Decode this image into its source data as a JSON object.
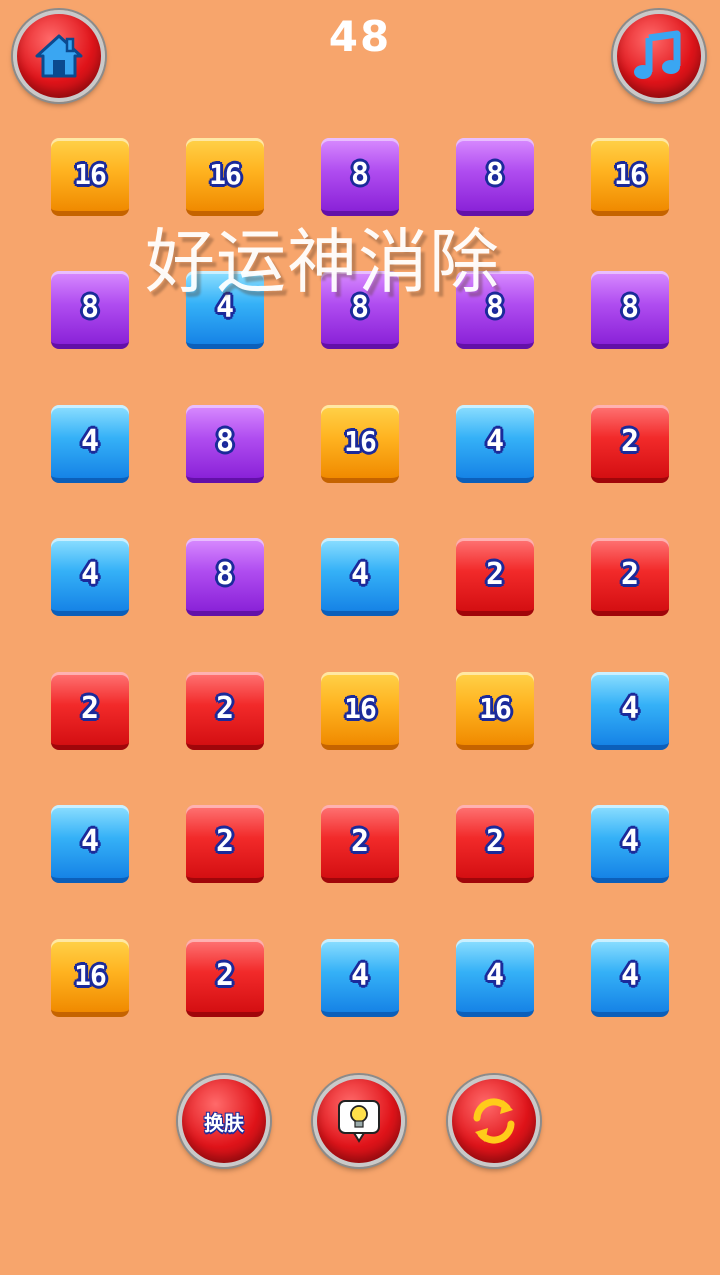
{
  "header": {
    "score": "48",
    "home_icon": "home-icon",
    "music_icon": "music-note-icon"
  },
  "overlay_text": "好运神消除",
  "board": {
    "rows": [
      [
        16,
        16,
        8,
        8,
        16
      ],
      [
        8,
        4,
        8,
        8,
        8
      ],
      [
        4,
        8,
        16,
        4,
        2
      ],
      [
        4,
        8,
        4,
        2,
        2
      ],
      [
        2,
        2,
        16,
        16,
        4
      ],
      [
        4,
        2,
        2,
        2,
        4
      ],
      [
        16,
        2,
        4,
        4,
        4
      ]
    ],
    "colors": {
      "2": "#f22a2a",
      "4": "#35b1f7",
      "8": "#b04df0",
      "16": "#ffb320"
    }
  },
  "toolbar": {
    "skin_label": "换肤",
    "hint_icon": "lightbulb-icon",
    "refresh_icon": "refresh-arrows-icon"
  },
  "theme": {
    "background": "#f7a56c",
    "button_red": "#e0141a",
    "digit_outline": "#1b2a9a"
  }
}
